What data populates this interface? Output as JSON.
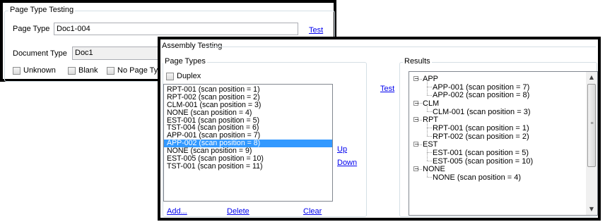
{
  "page_type_window": {
    "group_title": "Page Type Testing",
    "page_type_label": "Page Type",
    "page_type_value": "Doc1-004",
    "test_link": "Test",
    "document_type_label": "Document Type",
    "document_type_value": "Doc1",
    "checkboxes": [
      "Unknown",
      "Blank",
      "No Page Ty"
    ]
  },
  "assembly_window": {
    "group_title": "Assembly Testing",
    "page_types": {
      "title": "Page Types",
      "duplex_label": "Duplex",
      "items": [
        "RPT-001 (scan position = 1)",
        "RPT-002 (scan position = 2)",
        "CLM-001 (scan position = 3)",
        "NONE (scan position = 4)",
        "EST-001 (scan position = 5)",
        "TST-004 (scan position = 6)",
        "APP-001 (scan position = 7)",
        "APP-002 (scan position = 8)",
        "NONE (scan position = 9)",
        "EST-005 (scan position = 10)",
        "TST-001 (scan position = 11)"
      ],
      "selected_index": 7,
      "up_link": "Up",
      "down_link": "Down",
      "add_link": "Add...",
      "delete_link": "Delete",
      "clear_link": "Clear"
    },
    "test_link": "Test",
    "results": {
      "title": "Results",
      "tree": [
        {
          "label": "APP",
          "children": [
            "APP-001 (scan position = 7)",
            "APP-002 (scan position = 8)"
          ]
        },
        {
          "label": "CLM",
          "children": [
            "CLM-001 (scan position = 3)"
          ]
        },
        {
          "label": "RPT",
          "children": [
            "RPT-001 (scan position = 1)",
            "RPT-002 (scan position = 2)"
          ]
        },
        {
          "label": "EST",
          "children": [
            "EST-001 (scan position = 5)",
            "EST-005 (scan position = 10)"
          ]
        },
        {
          "label": "NONE",
          "children": [
            "NONE (scan position = 4)"
          ]
        }
      ],
      "expander_symbol": "−",
      "scroll_up_icon": "▲",
      "scroll_down_icon": "▼"
    }
  },
  "colors": {
    "link": "#0000ee",
    "selection": "#3399ff",
    "border_dark": "#000000",
    "group_border": "#d5dfe5"
  }
}
